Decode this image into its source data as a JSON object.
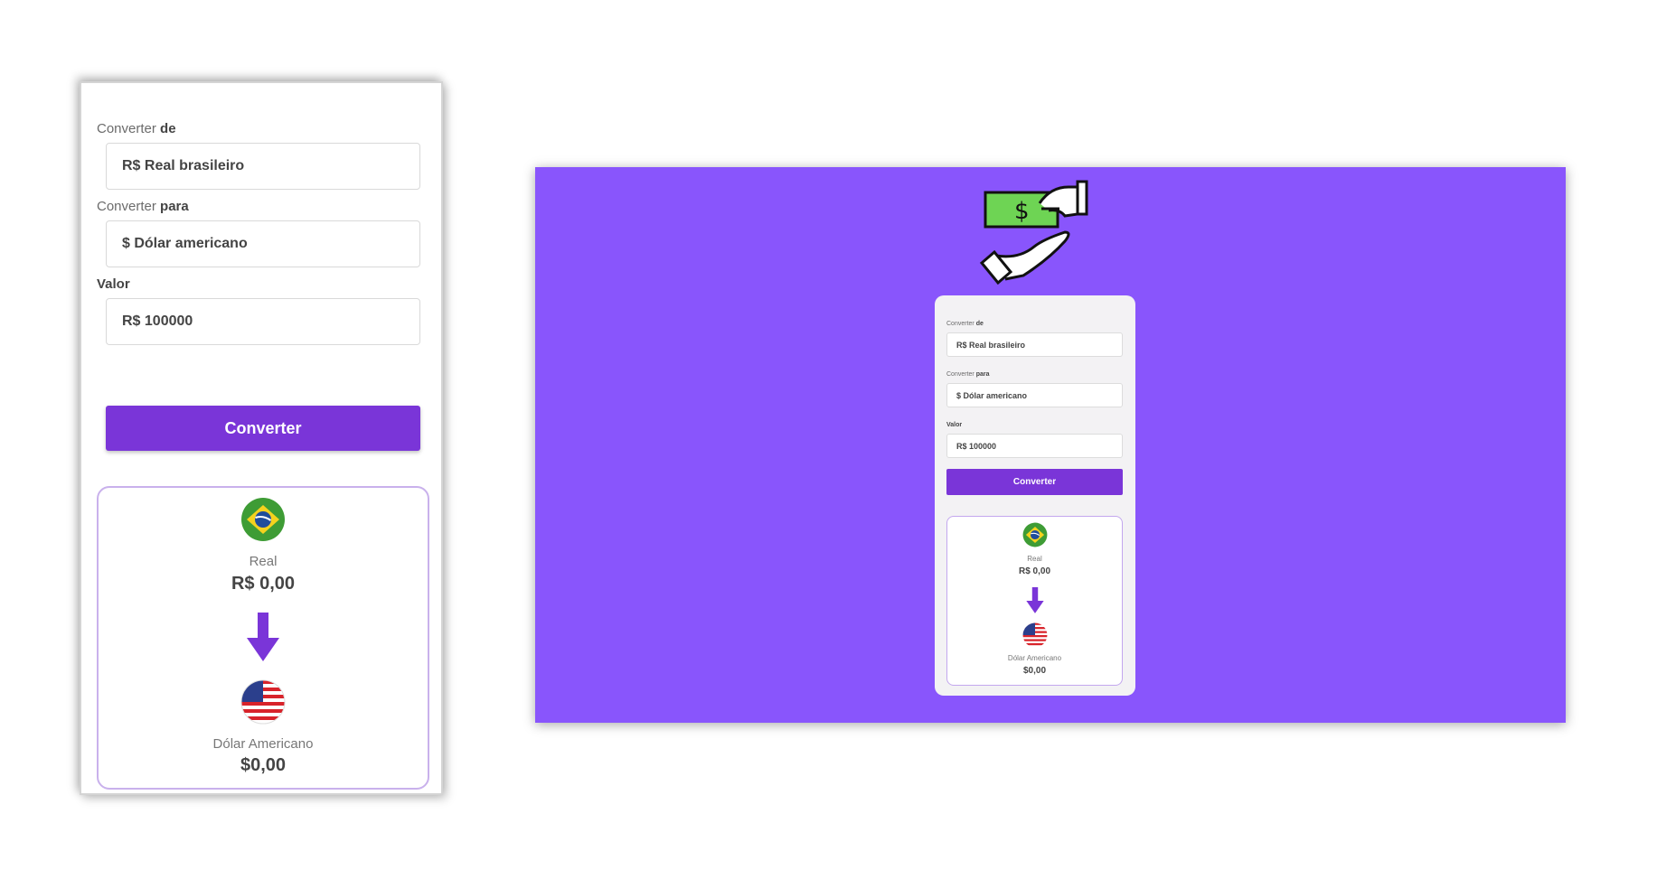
{
  "form": {
    "from_label_prefix": "Converter ",
    "from_label_bold": "de",
    "from_value": "R$ Real brasileiro",
    "to_label_prefix": "Converter ",
    "to_label_bold": "para",
    "to_value": "$ Dólar americano",
    "amount_label": "Valor",
    "amount_value": "R$ 100000",
    "button_label": "Converter"
  },
  "result": {
    "from_currency_name": "Real",
    "from_currency_value": "R$ 0,00",
    "to_currency_name": "Dólar Americano",
    "to_currency_value": "$0,00"
  },
  "logo": {
    "symbol": "$"
  },
  "colors": {
    "accent": "#7a35d8",
    "background": "#8955fc",
    "bill": "#6ed454",
    "result_border": "#c9b1ec"
  },
  "icons": [
    "brazil-flag-icon",
    "arrow-down-icon",
    "usa-flag-icon",
    "money-hand-icon"
  ]
}
